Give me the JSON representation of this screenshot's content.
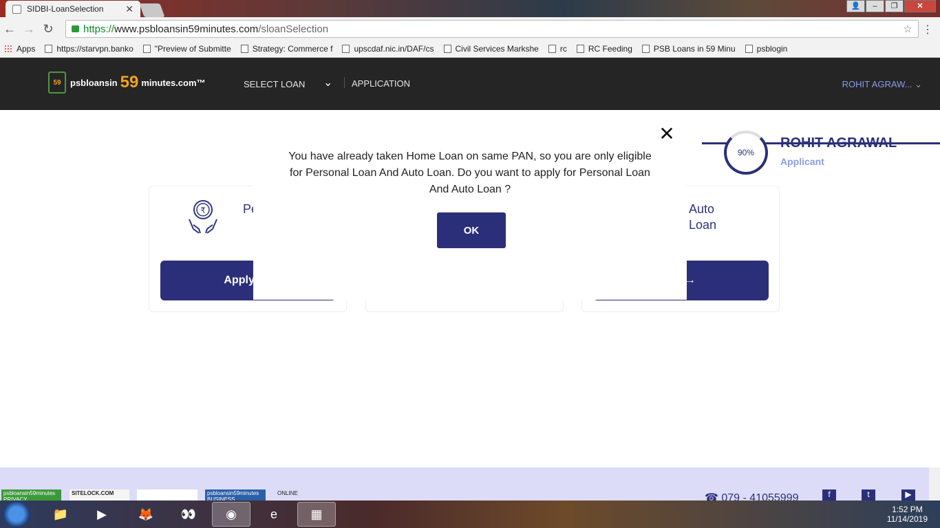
{
  "browser": {
    "tab_title": "SIDBI-LoanSelection",
    "url_secure": "https://",
    "url_host": "www.psbloansin59minutes.com",
    "url_path": "/sloanSelection",
    "bookmarks": [
      "Apps",
      "https://starvpn.banko",
      "\"Preview of Submitte",
      "Strategy: Commerce f",
      "upscdaf.nic.in/DAF/cs",
      "Civil Services Markshe",
      "rc",
      "RC Feeding",
      "PSB Loans in 59 Minu",
      "psblogin"
    ]
  },
  "header": {
    "logo_prefix": "psbloansin",
    "logo_number": "59",
    "logo_suffix": "minutes.com™",
    "logo_badge": "59",
    "nav_select_loan": "SELECT LOAN",
    "nav_application": "APPLICATION",
    "user_menu": "ROHIT AGRAW..."
  },
  "progress": {
    "percent_label": "90%",
    "name": "ROHIT AGRAWAL",
    "role": "Applicant"
  },
  "cards": {
    "left": {
      "title": "Pe",
      "button": "Apply No"
    },
    "right": {
      "title_line1": "Auto",
      "title_line2": "Loan",
      "button": "ow →"
    }
  },
  "modal": {
    "message": "You have already taken Home Loan on same PAN, so you are only eligible for Personal Loan And Auto Loan. Do you want to apply for Personal Loan And Auto Loan ?",
    "ok_label": "OK",
    "close_glyph": "✕"
  },
  "footer": {
    "phone": "☎ 079 - 41055999",
    "badges": [
      "psbloansin59minutes PRIVACY",
      "SITELOCK.COM",
      "psbloansin59minutes BUSINESS",
      "ONLINE"
    ]
  },
  "taskbar": {
    "time": "1:52 PM",
    "date": "11/14/2019"
  }
}
